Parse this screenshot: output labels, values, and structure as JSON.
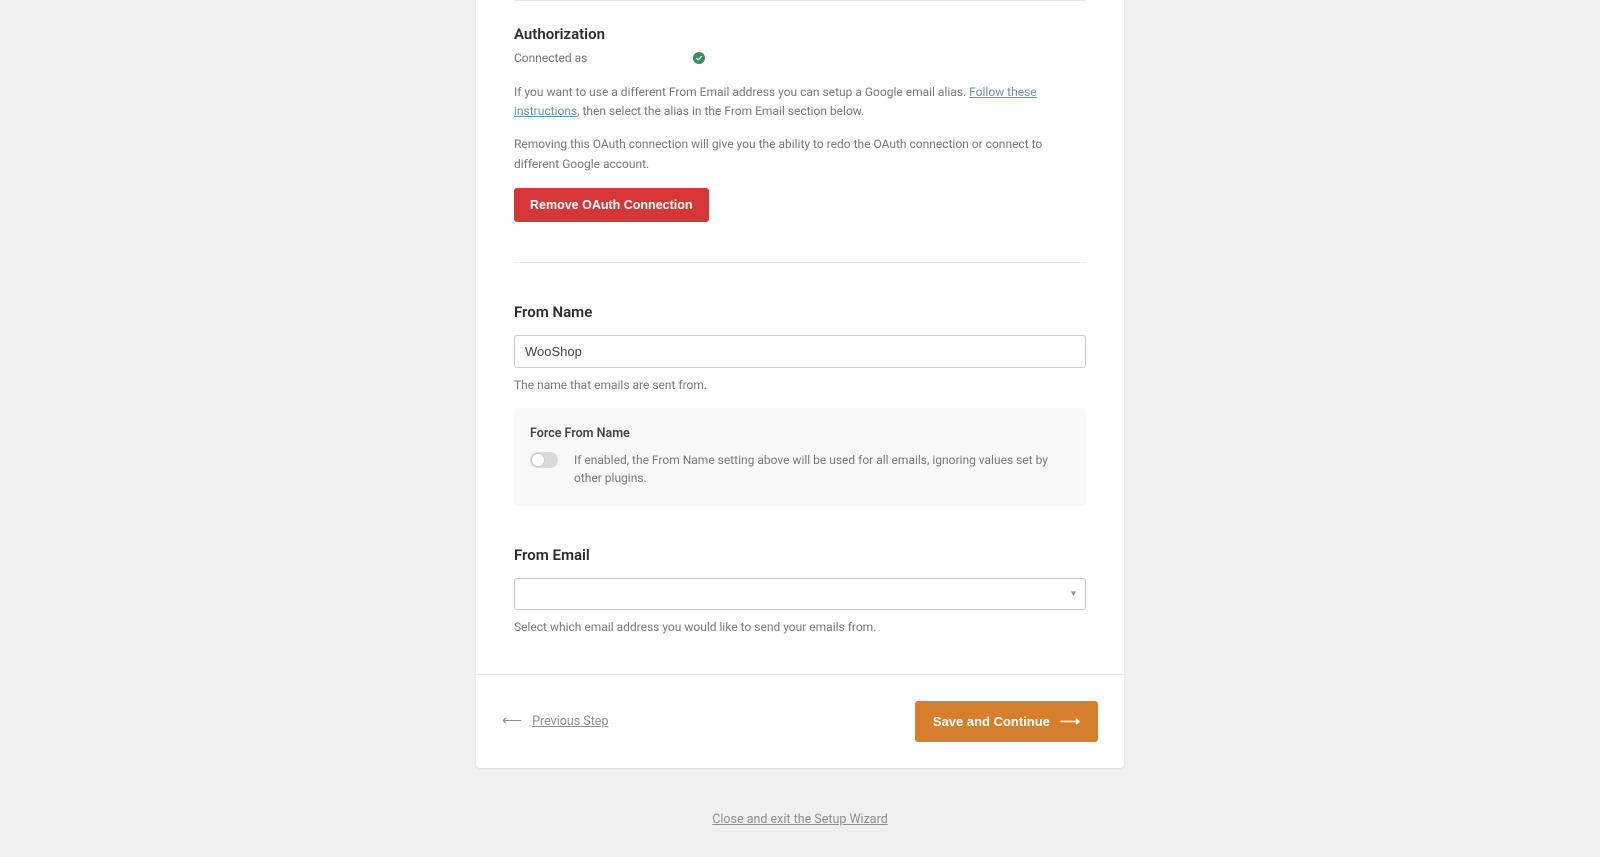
{
  "authorization": {
    "heading": "Authorization",
    "connected_label": "Connected as",
    "connected_email": "",
    "help1_pre": "If you want to use a different From Email address you can setup a Google email alias. ",
    "help1_link": "Follow these instructions",
    "help1_post": ", then select the alias in the From Email section below.",
    "help2": "Removing this OAuth connection will give you the ability to redo the OAuth connection or connect to different Google account.",
    "remove_btn": "Remove OAuth Connection"
  },
  "from_name": {
    "heading": "From Name",
    "value": "WooShop",
    "desc": "The name that emails are sent from.",
    "force_heading": "Force From Name",
    "force_desc": "If enabled, the From Name setting above will be used for all emails, ignoring values set by other plugins."
  },
  "from_email": {
    "heading": "From Email",
    "selected": "",
    "desc": "Select which email address you would like to send your emails from."
  },
  "footer": {
    "prev": "Previous Step",
    "save": "Save and Continue"
  },
  "exit_link": "Close and exit the Setup Wizard"
}
